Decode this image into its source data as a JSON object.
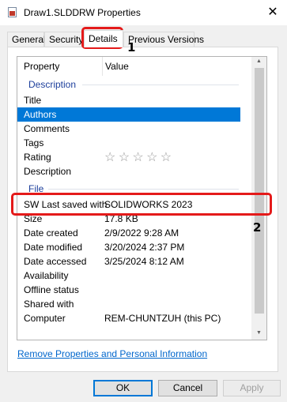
{
  "window": {
    "title": "Draw1.SLDDRW Properties",
    "close_glyph": "✕"
  },
  "tabs": [
    {
      "label": "General"
    },
    {
      "label": "Security"
    },
    {
      "label": "Details"
    },
    {
      "label": "Previous Versions"
    }
  ],
  "table": {
    "header_property": "Property",
    "header_value": "Value",
    "groups": {
      "description": "Description",
      "file": "File"
    },
    "description_rows": [
      {
        "key": "Title",
        "value": ""
      },
      {
        "key": "Authors",
        "value": ""
      },
      {
        "key": "Comments",
        "value": ""
      },
      {
        "key": "Tags",
        "value": ""
      },
      {
        "key": "Rating",
        "value": ""
      },
      {
        "key": "Description",
        "value": ""
      }
    ],
    "rating_stars": [
      "☆",
      "☆",
      "☆",
      "☆",
      "☆"
    ],
    "file_rows": [
      {
        "key": "SW Last saved with",
        "value": "SOLIDWORKS 2023"
      },
      {
        "key": "Size",
        "value": "17.8 KB"
      },
      {
        "key": "Date created",
        "value": "2/9/2022 9:28 AM"
      },
      {
        "key": "Date modified",
        "value": "3/20/2024 2:37 PM"
      },
      {
        "key": "Date accessed",
        "value": "3/25/2024 8:12 AM"
      },
      {
        "key": "Availability",
        "value": ""
      },
      {
        "key": "Offline status",
        "value": ""
      },
      {
        "key": "Shared with",
        "value": ""
      },
      {
        "key": "Computer",
        "value": "REM-CHUNTZUH (this PC)"
      }
    ]
  },
  "link": "Remove Properties and Personal Information",
  "buttons": {
    "ok": "OK",
    "cancel": "Cancel",
    "apply": "Apply"
  },
  "annotations": {
    "badge1": "1",
    "badge2": "2"
  },
  "colors": {
    "selection": "#0078d7",
    "group_heading": "#1d3f9c",
    "callout": "#e41a1a",
    "link": "#0066cc"
  }
}
